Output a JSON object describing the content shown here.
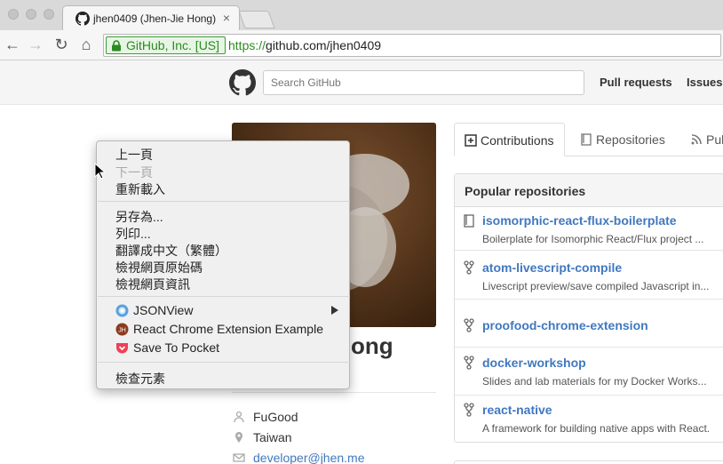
{
  "browser": {
    "tab_title": "jhen0409 (Jhen-Jie Hong)",
    "tab_close": "×",
    "ev_label": "GitHub, Inc. [US]",
    "url_scheme": "https://",
    "url_rest": "github.com/jhen0409",
    "back": "←",
    "forward": "→",
    "reload": "↻",
    "home": "⌂"
  },
  "header": {
    "search_placeholder": "Search GitHub",
    "nav": [
      "Pull requests",
      "Issues"
    ]
  },
  "profile": {
    "name_visible": "ong",
    "company": "FuGood",
    "location": "Taiwan",
    "email": "developer@jhen.me"
  },
  "profile_tabs": [
    {
      "label": "Contributions",
      "icon": "contributions-icon"
    },
    {
      "label": "Repositories",
      "icon": "repo-icon"
    },
    {
      "label": "Pub",
      "icon": "rss-icon"
    }
  ],
  "popular": {
    "title": "Popular repositories",
    "repos": [
      {
        "name": "isomorphic-react-flux-boilerplate",
        "desc": "Boilerplate for Isomorphic React/Flux project ...",
        "icon": "repo-icon"
      },
      {
        "name": "atom-livescript-compile",
        "desc": "Livescript preview/save compiled Javascript in...",
        "icon": "fork-icon"
      },
      {
        "name": "proofood-chrome-extension",
        "desc": "",
        "icon": "fork-icon"
      },
      {
        "name": "docker-workshop",
        "desc": "Slides and lab materials for my Docker Works...",
        "icon": "fork-icon"
      },
      {
        "name": "react-native",
        "desc": "A framework for building native apps with React.",
        "icon": "fork-icon"
      }
    ]
  },
  "context_menu": {
    "back": "上一頁",
    "forward": "下一頁",
    "reload": "重新載入",
    "save_as": "另存為...",
    "print": "列印...",
    "translate": "翻譯成中文（繁體）",
    "view_source": "檢視網頁原始碼",
    "page_info": "檢視網頁資訊",
    "jsonview": "JSONView",
    "react_ext": "React Chrome Extension Example",
    "pocket": "Save To Pocket",
    "inspect": "檢查元素",
    "react_ext_badge": "JH"
  },
  "colors": {
    "link": "#4078c0",
    "ev_green": "#2c8a22",
    "pocket_red": "#ee4056"
  }
}
